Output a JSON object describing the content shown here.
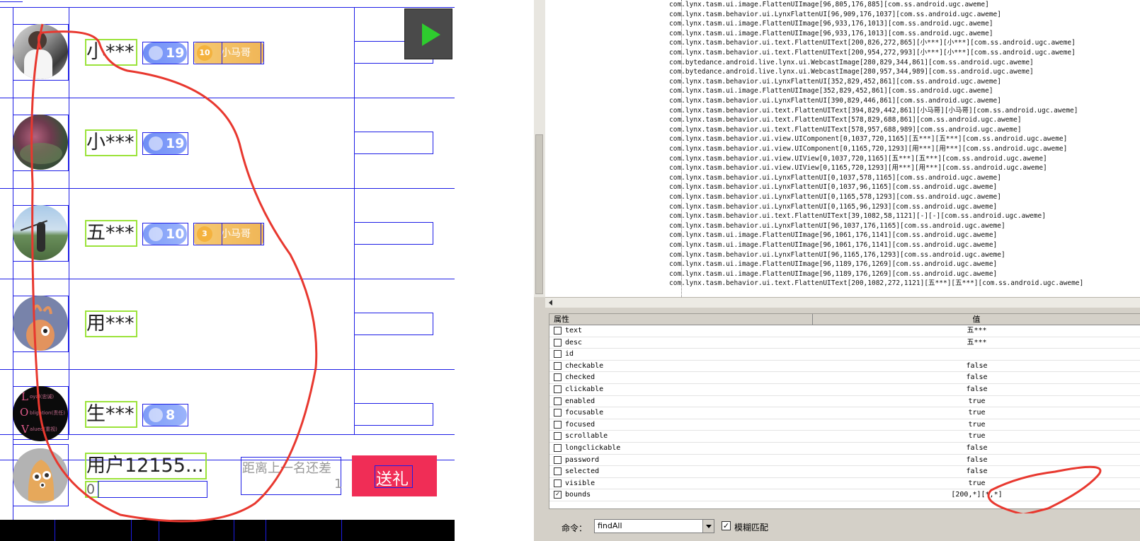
{
  "phone": {
    "rows": [
      {
        "name": "小***",
        "level": "19",
        "fan_level": "10",
        "fan_name": "小马哥"
      },
      {
        "name": "小***",
        "level": "19"
      },
      {
        "name": "五***",
        "level": "10",
        "fan_level": "3",
        "fan_name": "小马哥"
      },
      {
        "name": "用***"
      },
      {
        "name": "生***",
        "level": "8",
        "avatar_lines": [
          "L",
          "O",
          "V"
        ],
        "avatar_words": [
          "oyal(忠诚)",
          "bligation(责任)",
          "alued(重视)"
        ]
      }
    ],
    "me": {
      "name": "用户12155...",
      "score": "0",
      "gap_label": "距离上一名还差",
      "gap_value": "1",
      "gift_button": "送礼"
    }
  },
  "tree_lines": [
    "com.lynx.tasm.ui.image.FlattenUIImage[96,805,176,885][com.ss.android.ugc.aweme]",
    "com.lynx.tasm.behavior.ui.LynxFlattenUI[96,909,176,1037][com.ss.android.ugc.aweme]",
    "com.lynx.tasm.ui.image.FlattenUIImage[96,933,176,1013][com.ss.android.ugc.aweme]",
    "com.lynx.tasm.ui.image.FlattenUIImage[96,933,176,1013][com.ss.android.ugc.aweme]",
    "com.lynx.tasm.behavior.ui.text.FlattenUIText[200,826,272,865][小***][小***][com.ss.android.ugc.aweme]",
    "com.lynx.tasm.behavior.ui.text.FlattenUIText[200,954,272,993][小***][小***][com.ss.android.ugc.aweme]",
    "com.bytedance.android.live.lynx.ui.WebcastImage[280,829,344,861][com.ss.android.ugc.aweme]",
    "com.bytedance.android.live.lynx.ui.WebcastImage[280,957,344,989][com.ss.android.ugc.aweme]",
    "com.lynx.tasm.behavior.ui.LynxFlattenUI[352,829,452,861][com.ss.android.ugc.aweme]",
    "com.lynx.tasm.ui.image.FlattenUIImage[352,829,452,861][com.ss.android.ugc.aweme]",
    "com.lynx.tasm.behavior.ui.LynxFlattenUI[390,829,446,861][com.ss.android.ugc.aweme]",
    "com.lynx.tasm.behavior.ui.text.FlattenUIText[394,829,442,861][小马哥][小马哥][com.ss.android.ugc.aweme]",
    "com.lynx.tasm.behavior.ui.text.FlattenUIText[578,829,688,861][com.ss.android.ugc.aweme]",
    "com.lynx.tasm.behavior.ui.text.FlattenUIText[578,957,688,989][com.ss.android.ugc.aweme]",
    "com.lynx.tasm.behavior.ui.view.UIComponent[0,1037,720,1165][五***][五***][com.ss.android.ugc.aweme]",
    "com.lynx.tasm.behavior.ui.view.UIComponent[0,1165,720,1293][用***][用***][com.ss.android.ugc.aweme]",
    "com.lynx.tasm.behavior.ui.view.UIView[0,1037,720,1165][五***][五***][com.ss.android.ugc.aweme]",
    "com.lynx.tasm.behavior.ui.view.UIView[0,1165,720,1293][用***][用***][com.ss.android.ugc.aweme]",
    "com.lynx.tasm.behavior.ui.LynxFlattenUI[0,1037,578,1165][com.ss.android.ugc.aweme]",
    "com.lynx.tasm.behavior.ui.LynxFlattenUI[0,1037,96,1165][com.ss.android.ugc.aweme]",
    "com.lynx.tasm.behavior.ui.LynxFlattenUI[0,1165,578,1293][com.ss.android.ugc.aweme]",
    "com.lynx.tasm.behavior.ui.LynxFlattenUI[0,1165,96,1293][com.ss.android.ugc.aweme]",
    "com.lynx.tasm.behavior.ui.text.FlattenUIText[39,1082,58,1121][-][-][com.ss.android.ugc.aweme]",
    "com.lynx.tasm.behavior.ui.LynxFlattenUI[96,1037,176,1165][com.ss.android.ugc.aweme]",
    "com.lynx.tasm.ui.image.FlattenUIImage[96,1061,176,1141][com.ss.android.ugc.aweme]",
    "com.lynx.tasm.ui.image.FlattenUIImage[96,1061,176,1141][com.ss.android.ugc.aweme]",
    "com.lynx.tasm.behavior.ui.LynxFlattenUI[96,1165,176,1293][com.ss.android.ugc.aweme]",
    "com.lynx.tasm.ui.image.FlattenUIImage[96,1189,176,1269][com.ss.android.ugc.aweme]",
    "com.lynx.tasm.ui.image.FlattenUIImage[96,1189,176,1269][com.ss.android.ugc.aweme]",
    "com.lynx.tasm.behavior.ui.text.FlattenUIText[200,1082,272,1121][五***][五***][com.ss.android.ugc.aweme]"
  ],
  "props": {
    "header_name": "属性",
    "header_value": "值",
    "rows": [
      {
        "name": "text",
        "value": "五***",
        "checked": false
      },
      {
        "name": "desc",
        "value": "五***",
        "checked": false
      },
      {
        "name": "id",
        "value": "",
        "checked": false
      },
      {
        "name": "checkable",
        "value": "false",
        "checked": false
      },
      {
        "name": "checked",
        "value": "false",
        "checked": false
      },
      {
        "name": "clickable",
        "value": "false",
        "checked": false
      },
      {
        "name": "enabled",
        "value": "true",
        "checked": false
      },
      {
        "name": "focusable",
        "value": "true",
        "checked": false
      },
      {
        "name": "focused",
        "value": "true",
        "checked": false
      },
      {
        "name": "scrollable",
        "value": "true",
        "checked": false
      },
      {
        "name": "longclickable",
        "value": "false",
        "checked": false
      },
      {
        "name": "password",
        "value": "false",
        "checked": false
      },
      {
        "name": "selected",
        "value": "false",
        "checked": false
      },
      {
        "name": "visible",
        "value": "true",
        "checked": false
      },
      {
        "name": "bounds",
        "value": "[200,*][*,*]",
        "checked": true
      }
    ]
  },
  "command": {
    "label": "命令：",
    "value": "findAll",
    "fuzzy_label": "模糊匹配",
    "fuzzy_checked": "✓"
  },
  "colors": {
    "bounds_box": "#1d1de6",
    "text_box": "#9be33a",
    "annotation": "#e8382f",
    "gift": "#f02d56",
    "play": "#2ecc2e"
  },
  "icons": [
    "play-icon",
    "gem-icon",
    "coin-icon",
    "dropdown-arrow-icon",
    "checkbox-icon"
  ]
}
